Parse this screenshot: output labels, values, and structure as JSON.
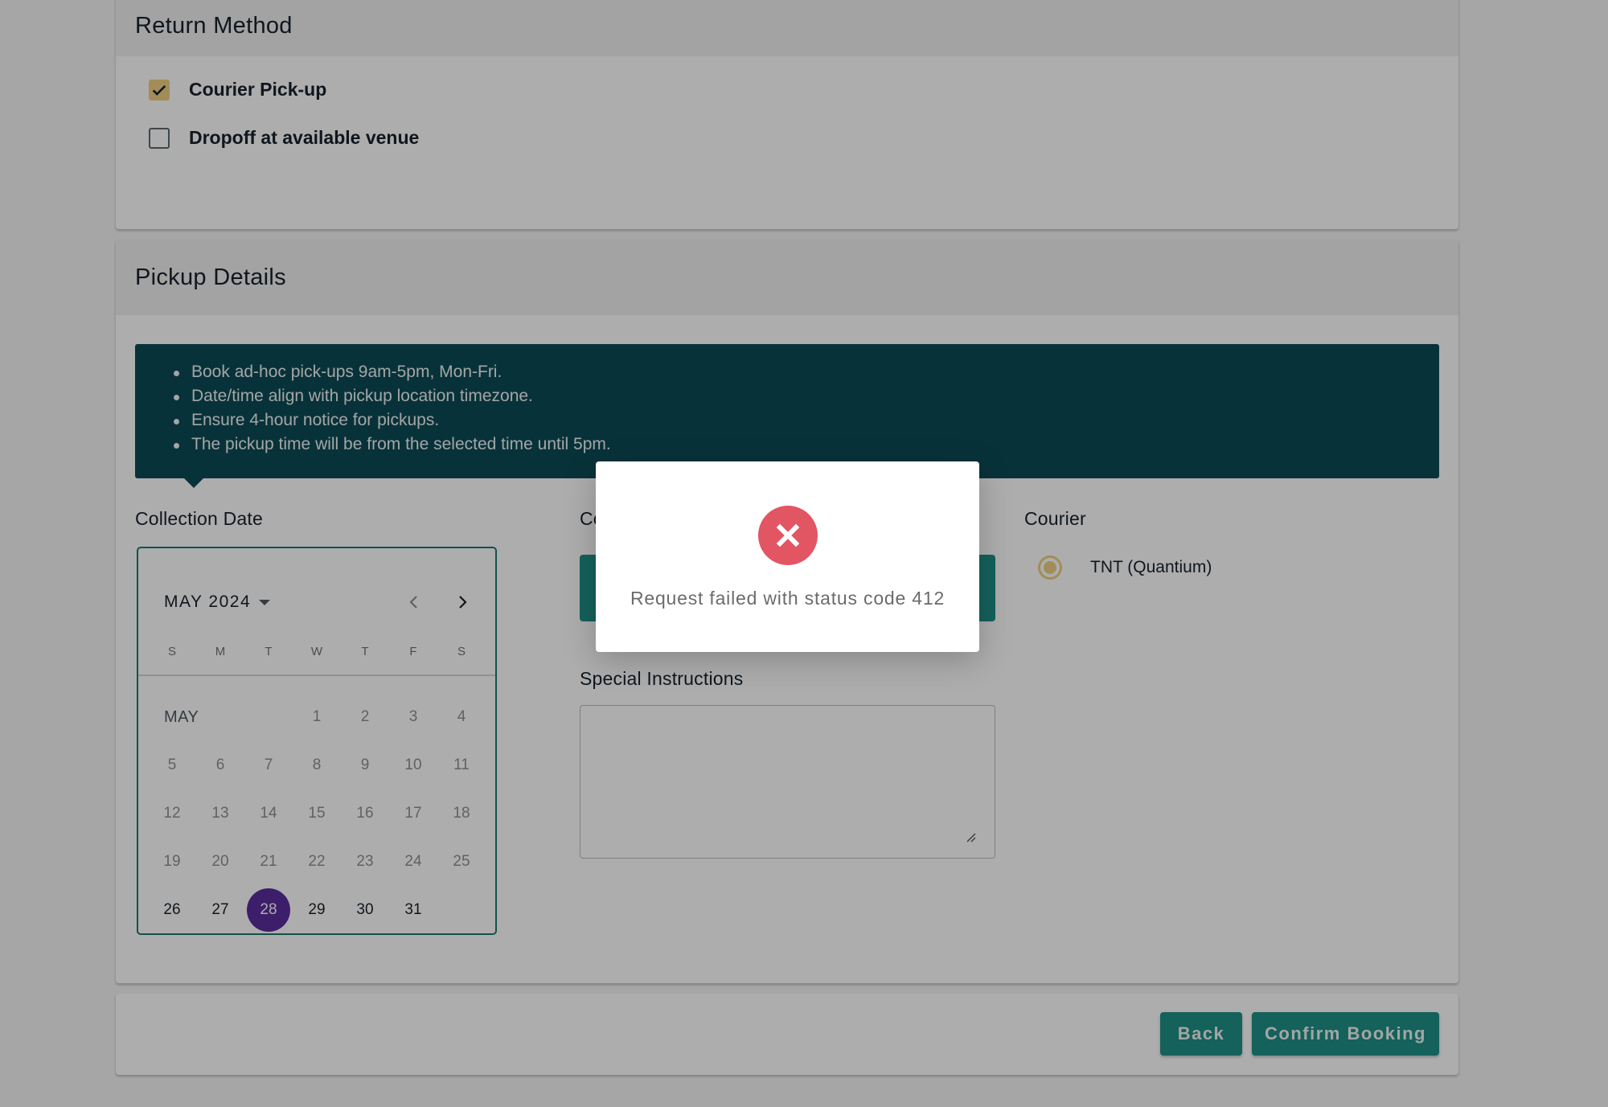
{
  "return_method": {
    "title": "Return Method",
    "options": [
      {
        "label": "Courier Pick-up",
        "checked": true
      },
      {
        "label": "Dropoff at available venue",
        "checked": false
      }
    ]
  },
  "pickup_details": {
    "title": "Pickup Details",
    "info_bullets": [
      "Book ad-hoc pick-ups 9am-5pm, Mon-Fri.",
      "Date/time align with pickup location timezone.",
      "Ensure 4-hour notice for pickups.",
      "The pickup time will be from the selected time until 5pm."
    ],
    "collection_date": {
      "label": "Collection Date",
      "calendar": {
        "month_year": "MAY 2024",
        "month_label": "MAY",
        "weekdays": [
          "S",
          "M",
          "T",
          "W",
          "T",
          "F",
          "S"
        ],
        "first_weekday_index": 3,
        "days_in_month": 31,
        "first_enabled_day": 26,
        "selected_day": 28
      }
    },
    "collection_time": {
      "label_partial": "Co"
    },
    "special_instructions": {
      "label": "Special Instructions",
      "value": "",
      "placeholder": ""
    },
    "courier": {
      "label": "Courier",
      "options": [
        {
          "label": "TNT (Quantium)",
          "selected": true
        }
      ]
    }
  },
  "footer": {
    "back_label": "Back",
    "confirm_label": "Confirm Booking"
  },
  "error_dialog": {
    "icon": "error-x-icon",
    "message": "Request failed with status code 412"
  },
  "colors": {
    "primary": "#1f8f87",
    "banner": "#0d4b56",
    "accent": "#f0d080",
    "selected_date": "#5b2d9d",
    "error": "#e25563"
  }
}
